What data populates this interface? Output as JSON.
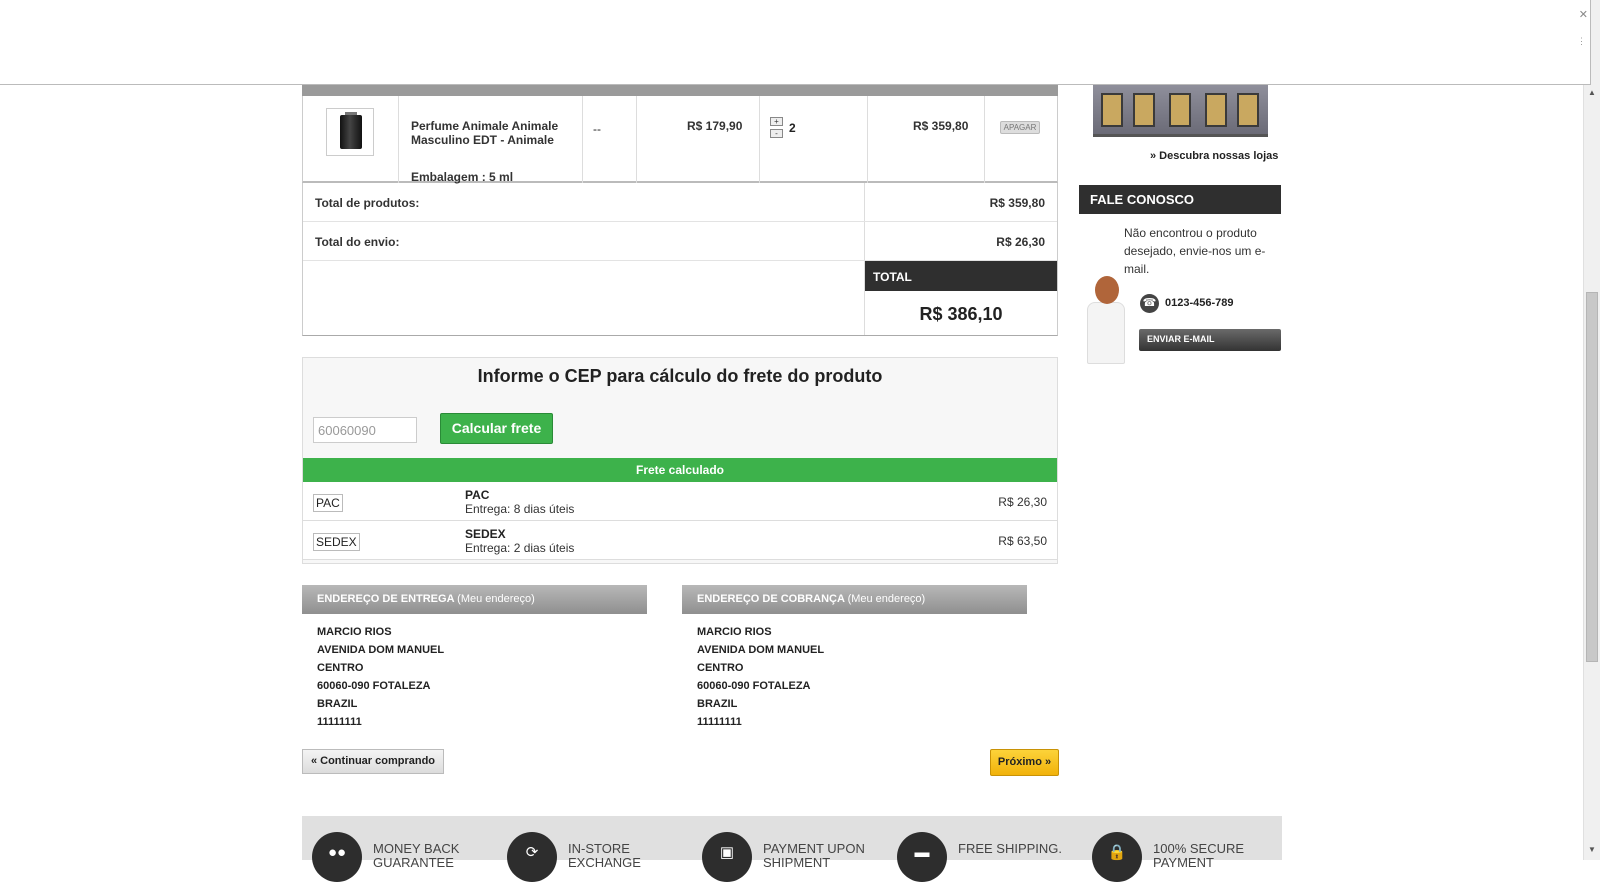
{
  "cart": {
    "item": {
      "name": "Perfume Animale Animale Masculino EDT - Animale",
      "packaging": "Embalagem : 5 ml",
      "variant": "--",
      "unit_price": "R$ 179,90",
      "quantity": "2",
      "qty_up": "+",
      "qty_down": "-",
      "line_total": "R$ 359,80",
      "delete_label": "APAGAR"
    },
    "totals": {
      "products_label": "Total de produtos:",
      "products_value": "R$ 359,80",
      "shipping_label": "Total do envio:",
      "shipping_value": "R$ 26,30",
      "total_label": "TOTAL",
      "total_value": "R$ 386,10"
    }
  },
  "freight": {
    "title": "Informe o CEP para cálculo do frete do produto",
    "cep_value": "60060090",
    "calc_button": "Calcular frete",
    "calculated_label": "Frete calculado",
    "options": [
      {
        "code": "PAC",
        "name": "PAC",
        "delivery": "Entrega: 8 dias úteis",
        "price": "R$ 26,30"
      },
      {
        "code": "SEDEX",
        "name": "SEDEX",
        "delivery": "Entrega: 2 dias úteis",
        "price": "R$ 63,50"
      }
    ]
  },
  "addresses": {
    "delivery": {
      "title": "ENDEREÇO DE ENTREGA",
      "subtitle": "(Meu endereço)",
      "lines": [
        "MARCIO RIOS",
        "AVENIDA DOM MANUEL",
        "CENTRO",
        "60060-090 FOTALEZA",
        "BRAZIL",
        "11111111"
      ]
    },
    "billing": {
      "title": "ENDEREÇO DE COBRANÇA",
      "subtitle": "(Meu endereço)",
      "lines": [
        "MARCIO RIOS",
        "AVENIDA DOM MANUEL",
        "CENTRO",
        "60060-090 FOTALEZA",
        "BRAZIL",
        "11111111"
      ]
    }
  },
  "navigation": {
    "continue_label": "« Continuar comprando",
    "next_label": "Próximo »"
  },
  "features": [
    {
      "label": "MONEY BACK GUARANTEE",
      "icon": "smiley-icon"
    },
    {
      "label": "IN-STORE EXCHANGE",
      "icon": "exchange-icon"
    },
    {
      "label": "PAYMENT UPON SHIPMENT",
      "icon": "payment-icon"
    },
    {
      "label": "FREE SHIPPING.",
      "icon": "truck-icon"
    },
    {
      "label": "100% SECURE PAYMENT",
      "icon": "lock-icon"
    }
  ],
  "sidebar": {
    "stores_link": "» Descubra nossas lojas",
    "contact_title": "FALE CONOSCO",
    "contact_text": "Não encontrou o produto desejado, envie-nos um e-mail.",
    "phone": "0123-456-789",
    "email_button": "ENVIAR E-MAIL"
  },
  "colors": {
    "accent_green": "#3db24b",
    "dark_header": "#2f2f2f",
    "next_button": "#f1b20a"
  }
}
